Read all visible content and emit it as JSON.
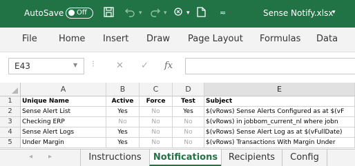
{
  "titlebar": {
    "autosave_label": "AutoSave",
    "autosave_state": "Off",
    "filename": "Sense Notify.xlsx",
    "icons": [
      "save-icon",
      "undo-icon",
      "redo-icon",
      "touch-mode-icon",
      "new-file-icon",
      "customize-qat-icon"
    ]
  },
  "menu": {
    "items": [
      "File",
      "Home",
      "Insert",
      "Draw",
      "Page Layout",
      "Formulas",
      "Data"
    ]
  },
  "formula_bar": {
    "name_box": "E43",
    "fx_label": "fx",
    "formula": ""
  },
  "grid": {
    "columns": [
      "A",
      "B",
      "C",
      "D",
      "E"
    ],
    "selected_column": "E",
    "row_numbers": [
      "1",
      "2",
      "3",
      "4",
      "5"
    ],
    "rows": [
      {
        "a": "Unique Name",
        "b": "Active",
        "c": "Force",
        "d": "Test",
        "e": "Subject"
      },
      {
        "a": "Sense Alert List",
        "b": "Yes",
        "c": "No",
        "d": "Yes",
        "e": "$(vRows) Sense Alerts Configured as at $(vF"
      },
      {
        "a": "Checking ERP",
        "b": "No",
        "c": "No",
        "d": "No",
        "e": "$(vRows) in jobbom_current_nl where jobn"
      },
      {
        "a": "Sense Alert Logs",
        "b": "Yes",
        "c": "No",
        "d": "No",
        "e": "$(vRows) Sense Alert Log as at $(vFullDate)"
      },
      {
        "a": "Under Margin",
        "b": "Yes",
        "c": "No",
        "d": "No",
        "e": "$(vRows) Transactions With Margin Under"
      }
    ]
  },
  "sheet_tabs": {
    "tabs": [
      "Instructions",
      "Notifications",
      "Recipients",
      "Config"
    ],
    "active": "Notifications"
  },
  "colors": {
    "excel_green": "#217346",
    "header_gray": "#f3f3f3",
    "muted_text": "#a6a6a6"
  }
}
